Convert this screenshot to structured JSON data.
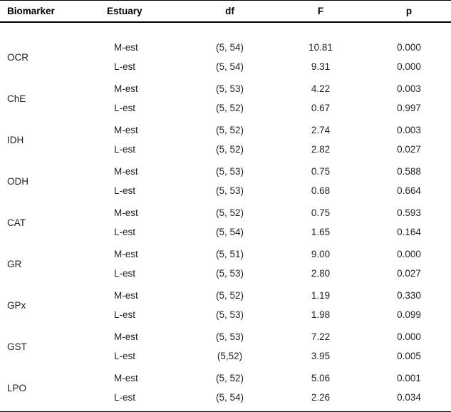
{
  "table": {
    "columns": [
      {
        "key": "biomarker",
        "label": "Biomarker",
        "align": "left"
      },
      {
        "key": "estuary",
        "label": "Estuary",
        "align": "center"
      },
      {
        "key": "df",
        "label": "df",
        "align": "center"
      },
      {
        "key": "f",
        "label": "F",
        "align": "center"
      },
      {
        "key": "p",
        "label": "p",
        "align": "center"
      }
    ],
    "groups": [
      {
        "biomarker": "OCR",
        "rows": [
          {
            "estuary": "M-est",
            "df": "(5, 54)",
            "f": "10.81",
            "p": "0.000"
          },
          {
            "estuary": "L-est",
            "df": "(5, 54)",
            "f": "9.31",
            "p": "0.000"
          }
        ]
      },
      {
        "biomarker": "ChE",
        "rows": [
          {
            "estuary": "M-est",
            "df": "(5, 53)",
            "f": "4.22",
            "p": "0.003"
          },
          {
            "estuary": "L-est",
            "df": "(5, 52)",
            "f": "0.67",
            "p": "0.997"
          }
        ]
      },
      {
        "biomarker": "IDH",
        "rows": [
          {
            "estuary": "M-est",
            "df": "(5, 52)",
            "f": "2.74",
            "p": "0.003"
          },
          {
            "estuary": "L-est",
            "df": "(5, 52)",
            "f": "2.82",
            "p": "0.027"
          }
        ]
      },
      {
        "biomarker": "ODH",
        "rows": [
          {
            "estuary": "M-est",
            "df": "(5, 53)",
            "f": "0.75",
            "p": "0.588"
          },
          {
            "estuary": "L-est",
            "df": "(5, 53)",
            "f": "0.68",
            "p": "0.664"
          }
        ]
      },
      {
        "biomarker": "CAT",
        "rows": [
          {
            "estuary": "M-est",
            "df": "(5, 52)",
            "f": "0.75",
            "p": "0.593"
          },
          {
            "estuary": "L-est",
            "df": "(5, 54)",
            "f": "1.65",
            "p": "0.164"
          }
        ]
      },
      {
        "biomarker": "GR",
        "rows": [
          {
            "estuary": "M-est",
            "df": "(5, 51)",
            "f": "9.00",
            "p": "0.000"
          },
          {
            "estuary": "L-est",
            "df": "(5, 53)",
            "f": "2.80",
            "p": "0.027"
          }
        ]
      },
      {
        "biomarker": "GPx",
        "rows": [
          {
            "estuary": "M-est",
            "df": "(5, 52)",
            "f": "1.19",
            "p": "0.330"
          },
          {
            "estuary": "L-est",
            "df": "(5, 53)",
            "f": "1.98",
            "p": "0.099"
          }
        ]
      },
      {
        "biomarker": "GST",
        "rows": [
          {
            "estuary": "M-est",
            "df": "(5, 53)",
            "f": "7.22",
            "p": "0.000"
          },
          {
            "estuary": "L-est",
            "df": "(5,52)",
            "f": "3.95",
            "p": "0.005"
          }
        ]
      },
      {
        "biomarker": "LPO",
        "rows": [
          {
            "estuary": "M-est",
            "df": "(5, 52)",
            "f": "5.06",
            "p": "0.001"
          },
          {
            "estuary": "L-est",
            "df": "(5, 54)",
            "f": "2.26",
            "p": "0.034"
          }
        ]
      }
    ]
  }
}
